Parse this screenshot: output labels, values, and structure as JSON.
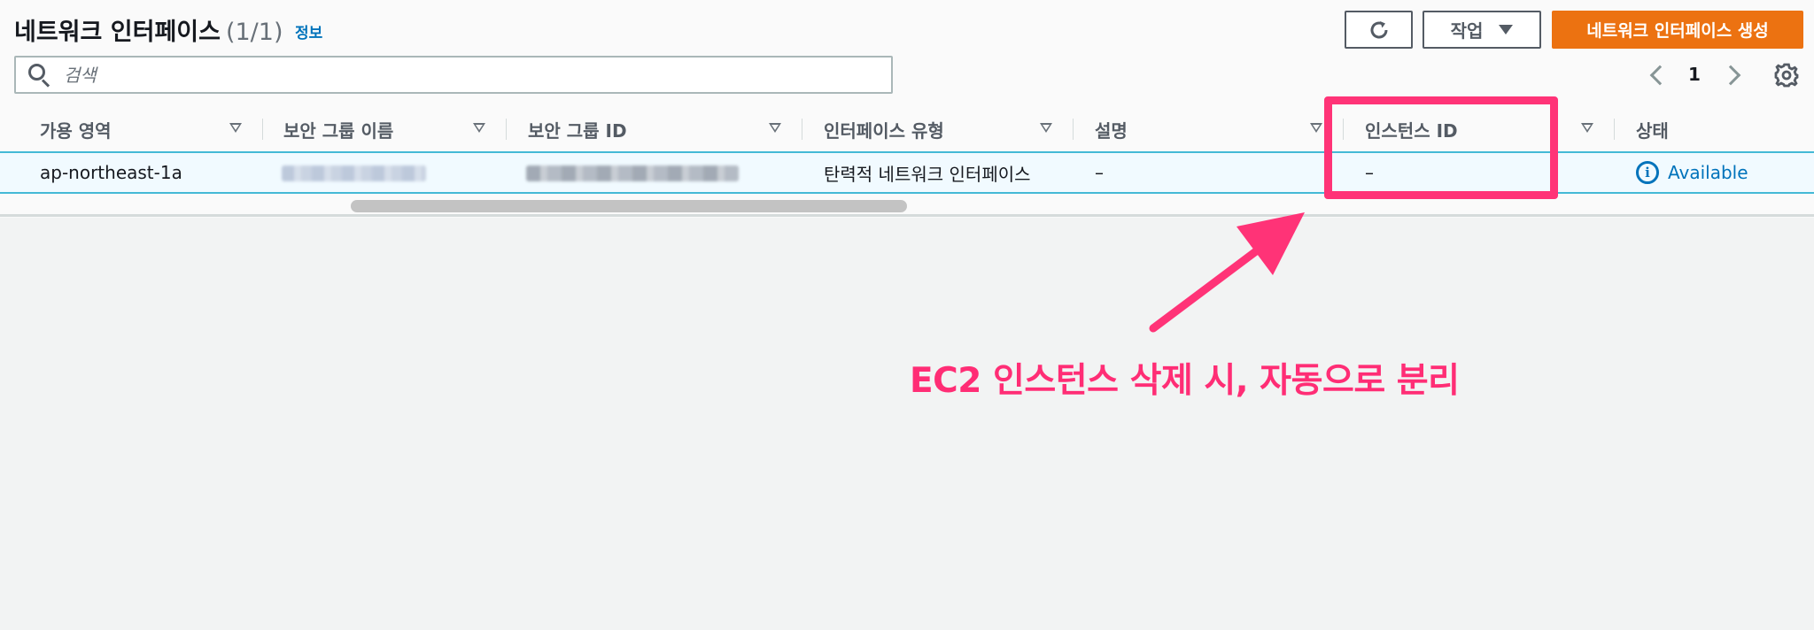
{
  "header": {
    "title": "네트워크 인터페이스",
    "count": "(1/1)",
    "info_link": "정보"
  },
  "toolbar": {
    "refresh_icon": "refresh-icon",
    "actions_label": "작업",
    "create_label": "네트워크 인터페이스 생성",
    "primary_color": "#ec7211"
  },
  "search": {
    "placeholder": "검색",
    "value": ""
  },
  "pagination": {
    "current_page": "1"
  },
  "table": {
    "columns": [
      "가용 영역",
      "보안 그룹 이름",
      "보안 그룹 ID",
      "인터페이스 유형",
      "설명",
      "인스턴스 ID",
      "상태"
    ],
    "rows": [
      {
        "availability_zone": "ap-northeast-1a",
        "interface_type": "탄력적 네트워크 인터페이스",
        "description": "–",
        "instance_id": "–",
        "status": "Available"
      }
    ],
    "selected_color": "#44b9d6"
  },
  "annotation": {
    "text": "EC2 인스턴스 삭제 시, 자동으로 분리",
    "color": "#ff2d75"
  }
}
